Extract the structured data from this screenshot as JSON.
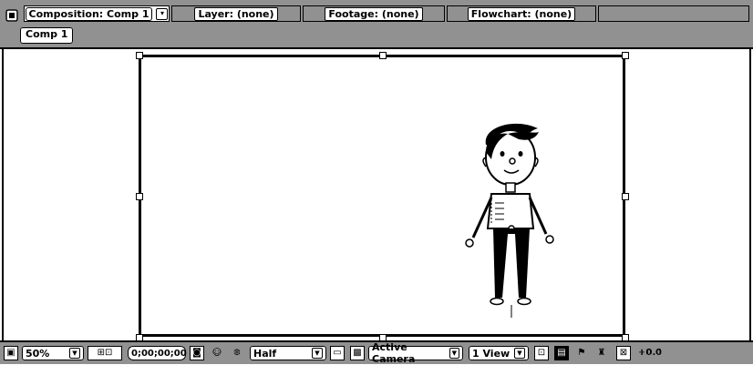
{
  "tabs": [
    {
      "label": "Composition: Comp 1",
      "active": true
    },
    {
      "label": "Layer: (none)",
      "active": false
    },
    {
      "label": "Footage: (none)",
      "active": false
    },
    {
      "label": "Flowchart: (none)",
      "active": false
    }
  ],
  "breadcrumb": {
    "label": "Comp 1"
  },
  "toolbar": {
    "zoom": "50%",
    "timecode": "0;00;00;00",
    "resolution": "Half",
    "camera": "Active Camera",
    "views": "1 View",
    "exposure": "+0.0"
  },
  "icons": {
    "panel_menu": "composition-panel-icon",
    "tab_close": "close-icon",
    "snapshot": "camera-icon",
    "show_snapshot": "person-icon",
    "color_channel": "rgb-channels-icon",
    "region": "region-of-interest-icon",
    "transparency": "transparency-grid-icon",
    "fast_preview": "fast-previews-icon",
    "draft3d": "draft-3d-icon",
    "flowchart": "flowchart-icon",
    "reset_exposure": "reset-exposure-icon"
  }
}
